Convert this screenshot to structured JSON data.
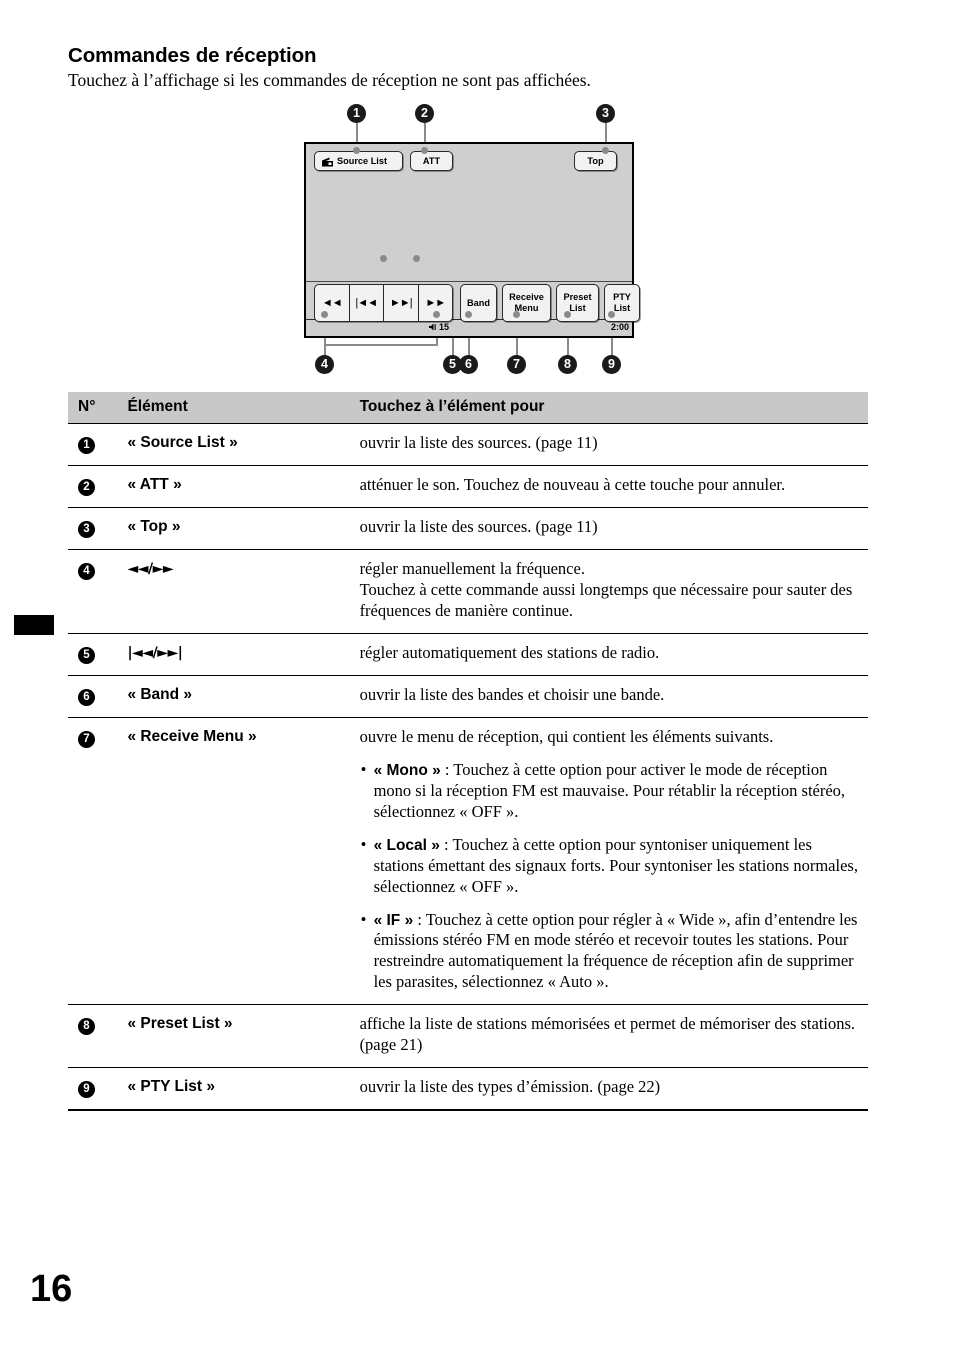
{
  "page": {
    "title": "Commandes de réception",
    "subtitle": "Touchez à l’affichage si les commandes de réception ne sont pas affichées.",
    "number": "16"
  },
  "figure": {
    "buttons": {
      "source_list": "Source List",
      "att": "ATT",
      "top": "Top",
      "band": "Band",
      "receive_menu_line1": "Receive",
      "receive_menu_line2": "Menu",
      "preset_list_line1": "Preset",
      "preset_list_line2": "List",
      "pty_list_line1": "PTY",
      "pty_list_line2": "List"
    },
    "transport": {
      "rew": "◄◄",
      "prev": "|◄◄",
      "next": "►►|",
      "ff": "►►"
    },
    "status": {
      "volume": "15",
      "clock": "2:00"
    },
    "callouts": [
      "1",
      "2",
      "3",
      "4",
      "5",
      "6",
      "7",
      "8",
      "9"
    ],
    "icons": {
      "source_list": "radio-icon",
      "volume": "speaker-icon"
    }
  },
  "table": {
    "headers": {
      "no": "N°",
      "element": "Élément",
      "action": "Touchez à l’élément pour"
    },
    "rows": [
      {
        "no": "1",
        "element": "« Source List »",
        "action": "ouvrir la liste des sources. (page 11)"
      },
      {
        "no": "2",
        "element": "« ATT »",
        "action": "atténuer le son. Touchez de nouveau à cette touche pour annuler."
      },
      {
        "no": "3",
        "element": "« Top »",
        "action": "ouvrir la liste des sources. (page 11)"
      },
      {
        "no": "4",
        "element": "◄◄/►►",
        "action": "régler manuellement la fréquence.\nTouchez à cette commande aussi longtemps que nécessaire pour sauter des fréquences de manière continue."
      },
      {
        "no": "5",
        "element": "|◄◄/►►|",
        "action": "régler automatiquement des stations de radio."
      },
      {
        "no": "6",
        "element": "« Band »",
        "action": "ouvrir la liste des bandes et choisir une bande."
      },
      {
        "no": "7",
        "element": "« Receive Menu »",
        "action": "ouvre le menu de réception, qui contient les éléments suivants.",
        "bullets": [
          {
            "term": "« Mono »",
            "text": " : Touchez à cette option pour activer le mode de réception mono si la réception FM est mauvaise. Pour rétablir la réception stéréo, sélectionnez « OFF »."
          },
          {
            "term": "« Local »",
            "text": " : Touchez à cette option pour syntoniser uniquement les stations émettant des signaux forts. Pour syntoniser les stations normales, sélectionnez « OFF »."
          },
          {
            "term": "« IF »",
            "text": " : Touchez à cette option pour régler à « Wide », afin d’entendre les émissions stéréo FM en mode stéréo et recevoir toutes les stations. Pour restreindre automatiquement la fréquence de réception afin de supprimer les parasites, sélectionnez « Auto »."
          }
        ]
      },
      {
        "no": "8",
        "element": "« Preset List »",
        "action": "affiche la liste de stations mémorisées et permet de mémoriser des stations. (page 21)"
      },
      {
        "no": "9",
        "element": "« PTY List »",
        "action": "ouvrir la liste des types d’émission. (page 22)"
      }
    ]
  }
}
